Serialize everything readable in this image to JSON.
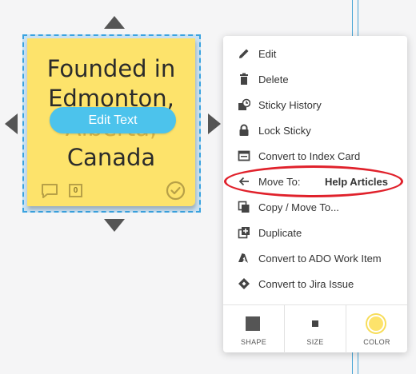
{
  "sticky": {
    "text_line1": "Founded in",
    "text_line2": "Edmonton,",
    "text_line3_faded": "Alberta,",
    "text_line4": "Canada",
    "edit_text_label": "Edit Text",
    "comment_count": "0",
    "color": "#fde36b"
  },
  "menu": {
    "items": [
      {
        "label": "Edit",
        "icon": "pencil-icon"
      },
      {
        "label": "Delete",
        "icon": "trash-icon"
      },
      {
        "label": "Sticky History",
        "icon": "history-icon"
      },
      {
        "label": "Lock Sticky",
        "icon": "lock-icon"
      },
      {
        "label": "Convert to Index Card",
        "icon": "index-card-icon"
      },
      {
        "label": "Move To:",
        "icon": "arrow-left-icon",
        "extra": "Help Articles"
      },
      {
        "label": "Copy / Move To...",
        "icon": "copy-icon"
      },
      {
        "label": "Duplicate",
        "icon": "duplicate-icon"
      },
      {
        "label": "Convert to ADO Work Item",
        "icon": "ado-icon"
      },
      {
        "label": "Convert to Jira Issue",
        "icon": "jira-icon"
      }
    ],
    "footer": {
      "shape_label": "SHAPE",
      "size_label": "SIZE",
      "color_label": "COLOR"
    }
  },
  "colors": {
    "selection": "#3aa3e0",
    "highlight_ring": "#e0212b",
    "edit_pill": "#4cc3ec"
  }
}
